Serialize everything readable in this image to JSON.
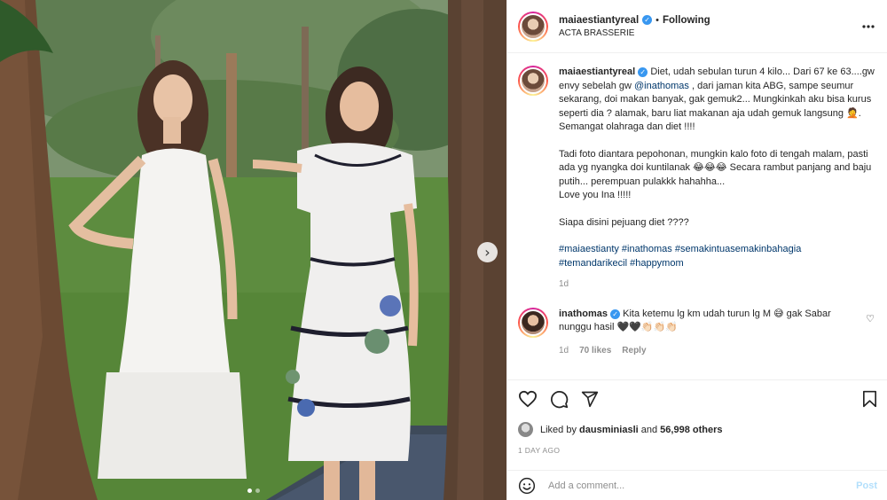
{
  "header": {
    "username": "maiaestiantyreal",
    "verified_mark": "✓",
    "separator": "•",
    "follow_status": "Following",
    "location": "ACTA BRASSERIE",
    "more_icon": "more-horizontal-icon"
  },
  "caption": {
    "username": "maiaestiantyreal",
    "para1_a": "Diet, udah sebulan turun 4 kilo... Dari 67 ke 63....gw envy sebelah gw ",
    "para1_mention": "@inathomas",
    "para1_b": " , dari jaman kita ABG, sampe seumur sekarang, doi makan banyak, gak gemuk2... Mungkinkah aku bisa kurus seperti dia ? alamak, baru liat makanan aja udah gemuk langsung 🤦. Semangat olahraga dan diet !!!!",
    "para2_a": "Tadi foto diantara pepohonan, mungkin kalo foto di tengah malam, pasti ada yg nyangka doi kuntilanak 😂😂😂 Secara rambut panjang and baju putih... perempuan pulakkk hahahha...",
    "para2_b": "Love you Ina !!!!!",
    "para3": "Siapa disini pejuang diet ????",
    "hashtags_1": "#maiaestianty #inathomas #semakintuasemakinbahagia",
    "hashtags_2": "#temandarikecil #happymom",
    "time": "1d"
  },
  "reply": {
    "username": "inathomas",
    "text": "Kita ketemu lg km udah turun lg M 😅 gak Sabar nunggu hasil 🖤🖤👏🏻👏🏻👏🏻",
    "time": "1d",
    "likes": "70 likes",
    "reply_label": "Reply",
    "heart": "♡"
  },
  "actions": {
    "icons": [
      "heart-icon",
      "comment-icon",
      "share-icon",
      "bookmark-icon"
    ],
    "liked_by_prefix": "Liked by ",
    "liked_by_user": "dausminiasli",
    "liked_by_mid": " and ",
    "liked_by_count": "56,998 others",
    "date": "1 DAY AGO"
  },
  "add_comment": {
    "placeholder": "Add a comment...",
    "post_label": "Post"
  },
  "carousel": {
    "next_glyph": "›",
    "current_index": 1,
    "total": 2
  },
  "colors": {
    "link": "#00376b",
    "muted": "#8e8e8e",
    "verified": "#3897f0",
    "post_disabled": "#b2dffc"
  }
}
